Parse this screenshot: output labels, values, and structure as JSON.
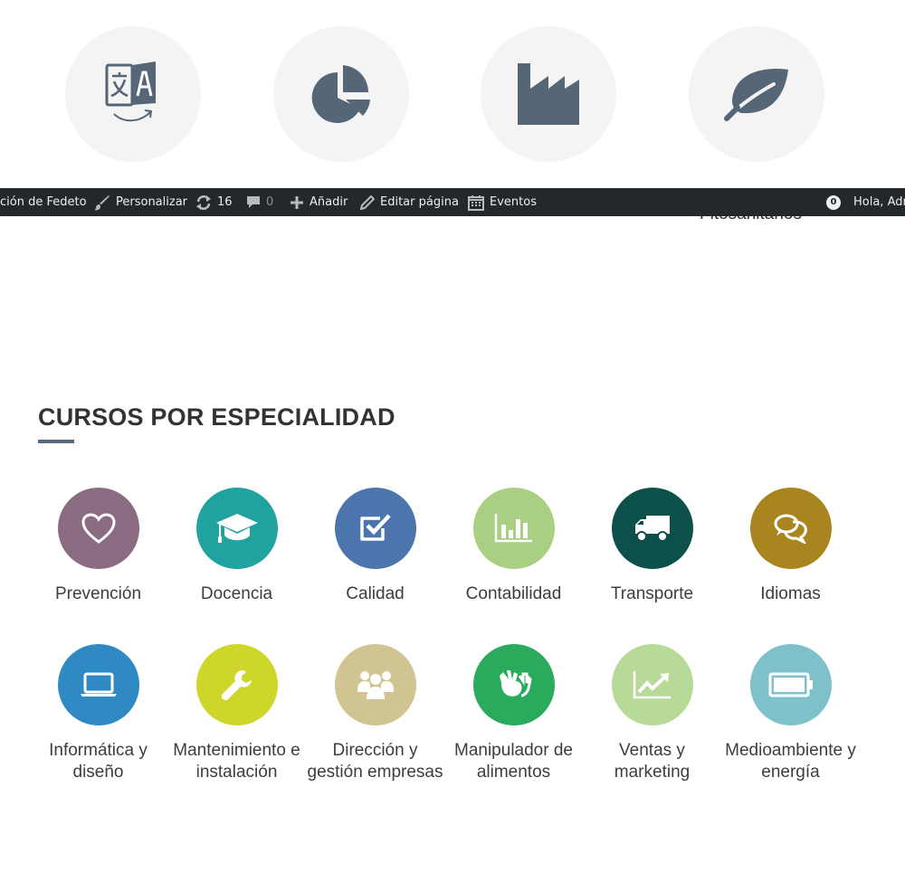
{
  "top_icons": [
    {
      "icon": "translate-icon",
      "bg": "#f4f4f5",
      "fg": "#556677"
    },
    {
      "icon": "pie-chart-icon",
      "bg": "#f4f4f5",
      "fg": "#556677"
    },
    {
      "icon": "factory-icon",
      "bg": "#f4f4f5",
      "fg": "#556677"
    },
    {
      "icon": "leaf-icon",
      "bg": "#f4f4f5",
      "fg": "#556677"
    }
  ],
  "partial_label": "Fitosanitarios",
  "admin_bar": {
    "site_name": "ción de Fedeto",
    "customize": "Personalizar",
    "updates_count": "16",
    "comments_count": "0",
    "add_new": "Añadir",
    "edit_page": "Editar página",
    "events": "Eventos",
    "notifications_count": "0",
    "greeting": "Hola, Adm"
  },
  "section": {
    "title": "CURSOS POR ESPECIALIDAD",
    "accent": "#576a7c"
  },
  "courses": [
    {
      "label": "Prevención",
      "icon": "heart-icon",
      "color": "#8b6b82"
    },
    {
      "label": "Docencia",
      "icon": "graduation-cap-icon",
      "color": "#20a39e"
    },
    {
      "label": "Calidad",
      "icon": "checkbox-icon",
      "color": "#4c74ad"
    },
    {
      "label": "Contabilidad",
      "icon": "bar-chart-icon",
      "color": "#a8cf82"
    },
    {
      "label": "Transporte",
      "icon": "truck-icon",
      "color": "#0d4f4a"
    },
    {
      "label": "Idiomas",
      "icon": "chat-bubbles-icon",
      "color": "#a8851f"
    },
    {
      "label": "Informática y diseño",
      "icon": "laptop-icon",
      "color": "#2f8ac4"
    },
    {
      "label": "Mantenimiento e instalación",
      "icon": "wrench-icon",
      "color": "#cdd629"
    },
    {
      "label": "Dirección y gestión empresas",
      "icon": "group-icon",
      "color": "#d1c493"
    },
    {
      "label": "Manipulador de alimentos",
      "icon": "hands-icon",
      "color": "#2aaa5d"
    },
    {
      "label": "Ventas y marketing",
      "icon": "trend-chart-icon",
      "color": "#b7da98"
    },
    {
      "label": "Medioambiente y energía",
      "icon": "battery-icon",
      "color": "#7fc1ca"
    }
  ]
}
